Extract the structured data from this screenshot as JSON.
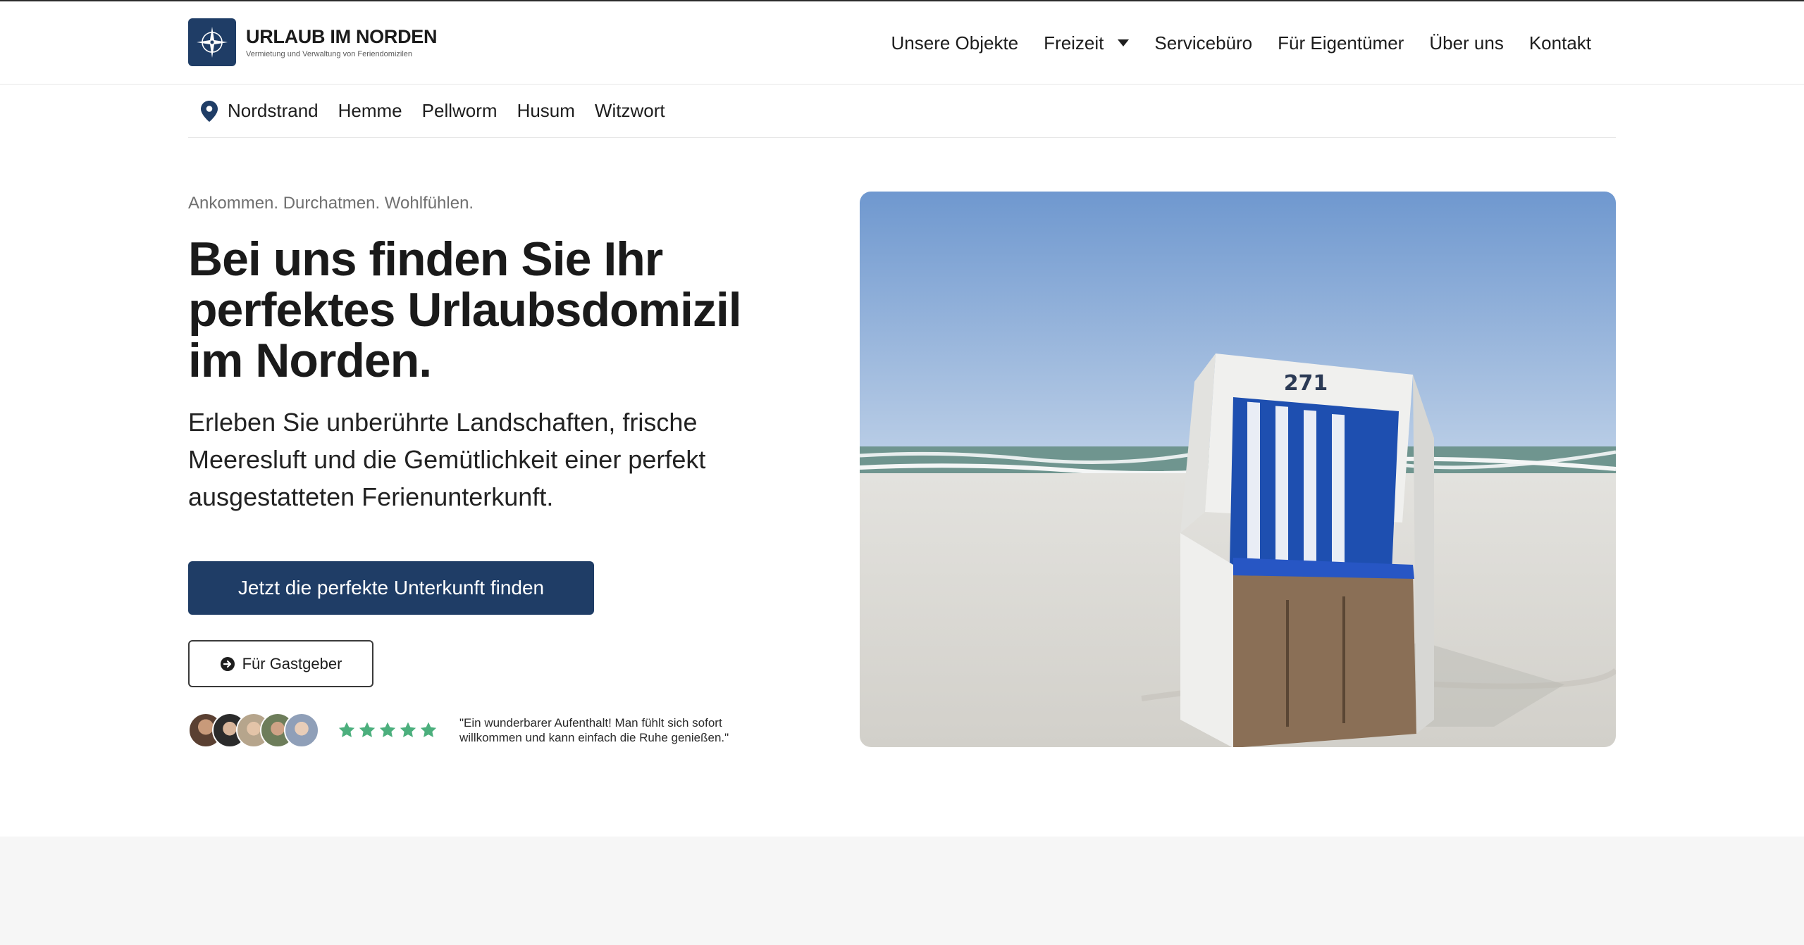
{
  "brand": {
    "title": "URLAUB IM NORDEN",
    "subtitle": "Vermietung und Verwaltung von Feriendomizilen",
    "color": "#1f3d66"
  },
  "nav": {
    "items": [
      {
        "label": "Unsere Objekte"
      },
      {
        "label": "Freizeit",
        "has_dropdown": true
      },
      {
        "label": "Servicebüro"
      },
      {
        "label": "Für Eigentümer"
      },
      {
        "label": "Über uns"
      },
      {
        "label": "Kontakt"
      }
    ]
  },
  "locations": {
    "icon": "map-pin-icon",
    "items": [
      "Nordstrand",
      "Hemme",
      "Pellworm",
      "Husum",
      "Witzwort"
    ]
  },
  "hero": {
    "tagline": "Ankommen. Durchatmen. Wohlfühlen.",
    "headline": "Bei uns finden Sie Ihr perfektes Urlaubsdomizil im Norden.",
    "lead": "Erleben Sie unberührte Landschaften, frische Meeresluft und die Gemütlichkeit einer perfekt ausgestatteten Ferienunterkunft.",
    "cta_primary": "Jetzt die perfekte Unterkunft finden",
    "cta_secondary": "Für Gastgeber",
    "beach_chair_number": "271"
  },
  "reviews": {
    "rating": 5,
    "star_color": "#4caf7d",
    "quote": "\"Ein wunderbarer Aufenthalt! Man fühlt sich sofort willkommen und kann einfach die Ruhe genießen.\""
  }
}
